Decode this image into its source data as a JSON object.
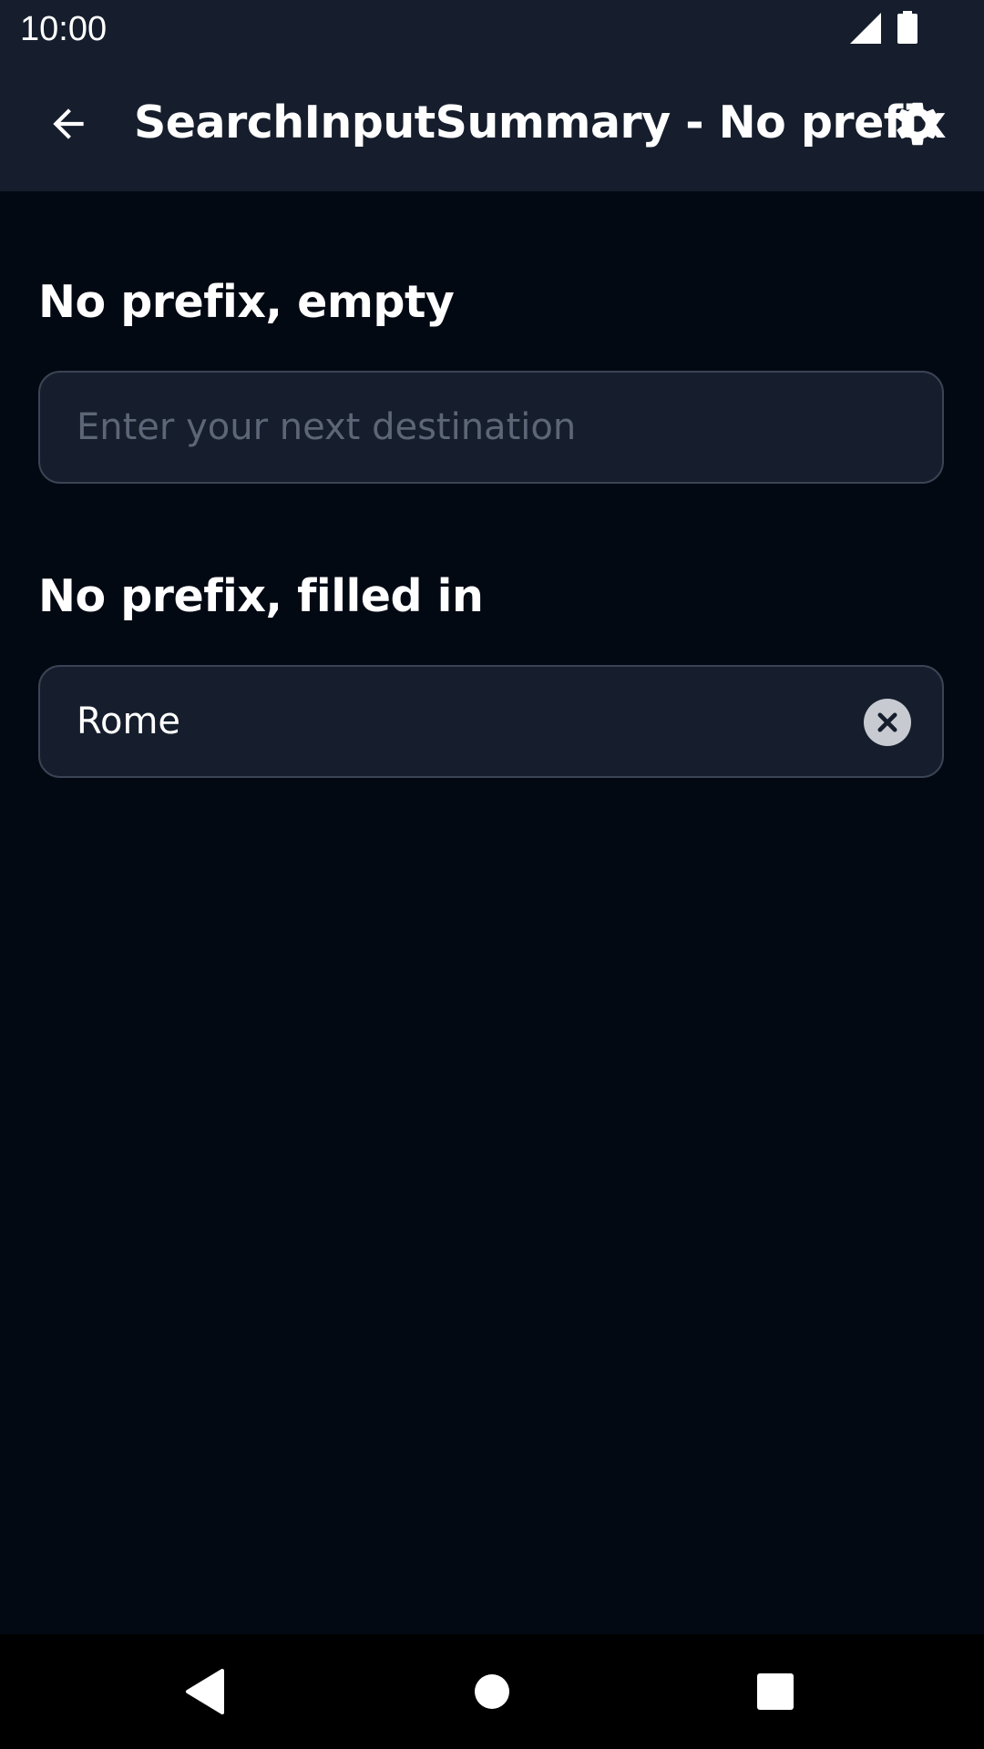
{
  "status_bar": {
    "time": "10:00",
    "icons": [
      "signal-icon",
      "battery-icon"
    ]
  },
  "app_bar": {
    "title": "SearchInputSummary - No prefix",
    "back_icon": "arrow-back-icon",
    "settings_icon": "gear-icon"
  },
  "sections": [
    {
      "title": "No prefix, empty",
      "input_value": "",
      "placeholder": "Enter your next destination"
    },
    {
      "title": "No prefix, filled in",
      "input_value": "Rome",
      "placeholder": "Enter your next destination",
      "clear_icon": "close-icon"
    }
  ],
  "nav_bar": {
    "icons": [
      "nav-back-icon",
      "nav-home-icon",
      "nav-recents-icon"
    ]
  },
  "colors": {
    "background": "#030913",
    "bar": "#161e2d",
    "field_border": "#3b4454",
    "placeholder": "#5c6677",
    "clear_button": "#c7cbd1"
  }
}
